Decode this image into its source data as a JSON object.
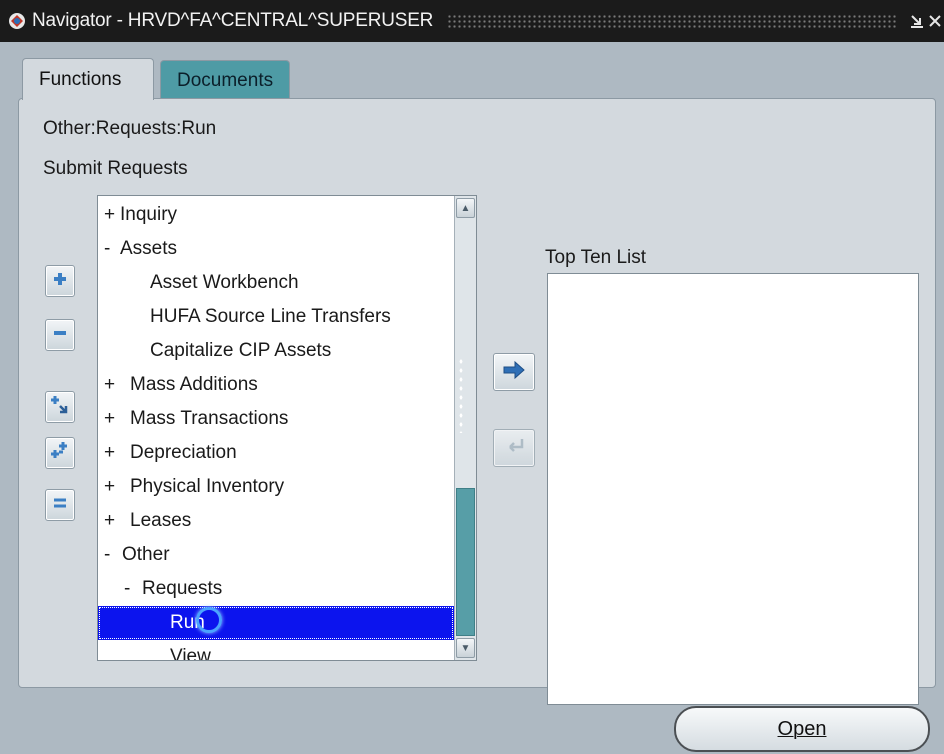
{
  "window": {
    "title": "Navigator - HRVD^FA^CENTRAL^SUPERUSER",
    "app_icon": "oracle-navigator-icon",
    "controls": [
      "minimize-icon",
      "close-icon"
    ]
  },
  "tabs": [
    {
      "label": "Functions",
      "active": true
    },
    {
      "label": "Documents",
      "active": false
    }
  ],
  "breadcrumb": "Other:Requests:Run",
  "function_title": "Submit Requests",
  "side_buttons": [
    "expand-icon",
    "collapse-icon",
    "expand-branch-icon",
    "expand-all-icon",
    "collapse-all-icon"
  ],
  "tree": {
    "items": [
      {
        "sign": "+",
        "label": "Inquiry"
      },
      {
        "sign": "-",
        "label": "Assets"
      },
      {
        "sign": "",
        "label": "Asset Workbench"
      },
      {
        "sign": "",
        "label": "HUFA Source Line Transfers"
      },
      {
        "sign": "",
        "label": "Capitalize CIP Assets"
      },
      {
        "sign": "+",
        "label": "Mass Additions"
      },
      {
        "sign": "+",
        "label": "Mass Transactions"
      },
      {
        "sign": "+",
        "label": "Depreciation"
      },
      {
        "sign": "+",
        "label": "Physical Inventory"
      },
      {
        "sign": "+",
        "label": "Leases"
      },
      {
        "sign": "-",
        "label": "Other"
      },
      {
        "sign": "-",
        "label": "Requests"
      },
      {
        "sign": "",
        "label": "Run"
      },
      {
        "sign": "",
        "label": "View"
      }
    ],
    "selected_label": "Run"
  },
  "top_ten": {
    "label": "Top Ten List",
    "items": []
  },
  "buttons": {
    "open_label": "Open",
    "open_mnemonic": "O"
  },
  "colors": {
    "selection": "#0c14ee",
    "tab_inactive": "#4e9ba5",
    "scroll_thumb": "#579ea7",
    "window_bg": "#aeb9c2",
    "panel_bg": "#d3d9de"
  }
}
